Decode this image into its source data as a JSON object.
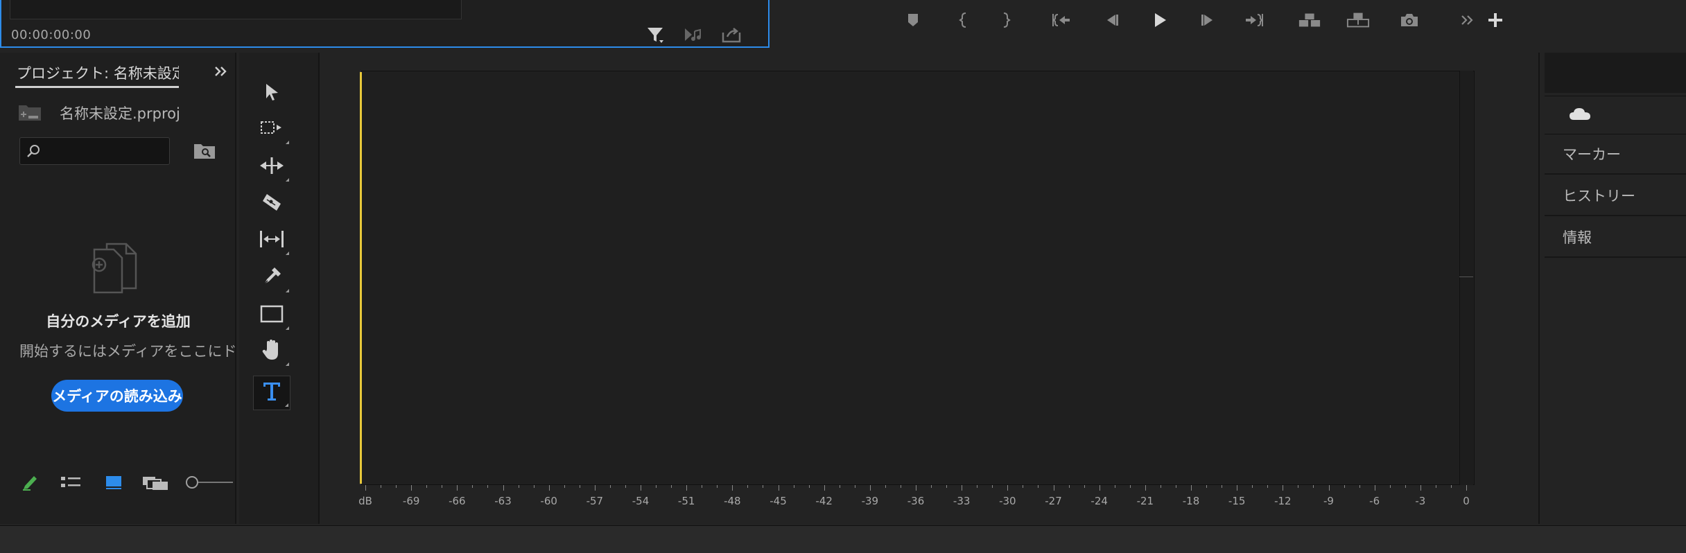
{
  "source_monitor": {
    "timecode": "00:00:00:00"
  },
  "project": {
    "tab_label": "プロジェクト: 名称未設定",
    "file_name": "名称未設定.prproj",
    "search_placeholder": "",
    "empty_title": "自分のメディアを追加",
    "empty_description": "開始するにはメディアをここにドラッグ",
    "import_button_label": "メディアの読み込み"
  },
  "tools": [
    {
      "name": "selection-tool",
      "icon": "arrow-pointer-icon"
    },
    {
      "name": "track-select-tool",
      "icon": "track-select-icon"
    },
    {
      "name": "ripple-edit-tool",
      "icon": "ripple-edit-icon"
    },
    {
      "name": "razor-tool",
      "icon": "razor-icon"
    },
    {
      "name": "slip-tool",
      "icon": "slip-icon"
    },
    {
      "name": "pen-tool",
      "icon": "pen-icon"
    },
    {
      "name": "rectangle-tool",
      "icon": "rectangle-icon"
    },
    {
      "name": "hand-tool",
      "icon": "hand-icon"
    },
    {
      "name": "type-tool",
      "icon": "type-icon"
    }
  ],
  "audio_meter": {
    "scale_labels": [
      "dB",
      "-69",
      "-66",
      "-63",
      "-60",
      "-57",
      "-54",
      "-51",
      "-48",
      "-45",
      "-42",
      "-39",
      "-36",
      "-33",
      "-30",
      "-27",
      "-24",
      "-21",
      "-18",
      "-15",
      "-12",
      "-9",
      "-6",
      "-3",
      "0"
    ]
  },
  "right_panels": {
    "items": [
      "マーカー",
      "ヒストリー",
      "情報"
    ]
  },
  "colors": {
    "accent_blue": "#1d74e2",
    "selection_border": "#2d8ceb",
    "peak_yellow": "#e8c83a",
    "pencil_green": "#4caf50"
  }
}
